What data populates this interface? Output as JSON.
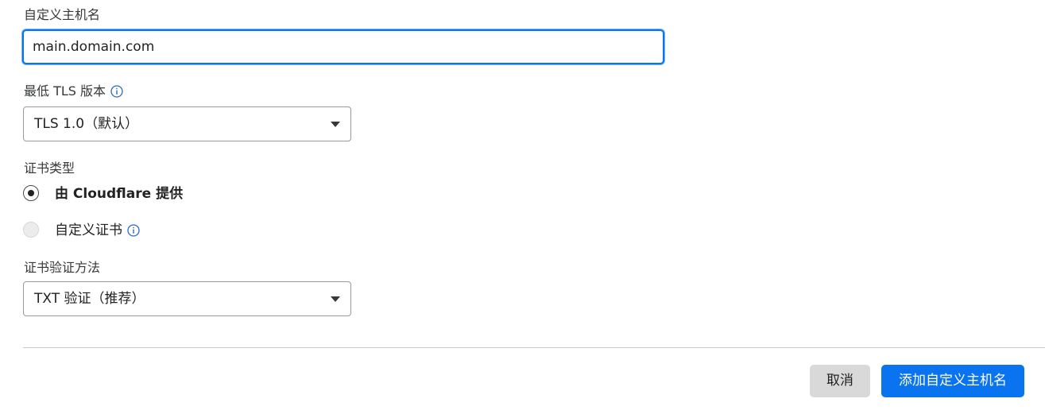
{
  "hostname_field": {
    "label": "自定义主机名",
    "value": "main.domain.com"
  },
  "tls_field": {
    "label": "最低 TLS 版本",
    "selected": "TLS 1.0（默认）"
  },
  "certificate_type": {
    "label": "证书类型",
    "options": [
      {
        "label": "由 Cloudflare 提供",
        "checked": true
      },
      {
        "label": "自定义证书",
        "checked": false
      }
    ]
  },
  "validation_method": {
    "label": "证书验证方法",
    "selected": "TXT 验证（推荐）"
  },
  "actions": {
    "cancel_label": "取消",
    "submit_label": "添加自定义主机名"
  },
  "colors": {
    "accent": "#0a74f0",
    "cancel_bg": "#d9d9d9",
    "info_icon": "#2a6bc4"
  },
  "icons": {
    "info": "info-circle-icon",
    "dropdown": "caret-down-icon"
  }
}
